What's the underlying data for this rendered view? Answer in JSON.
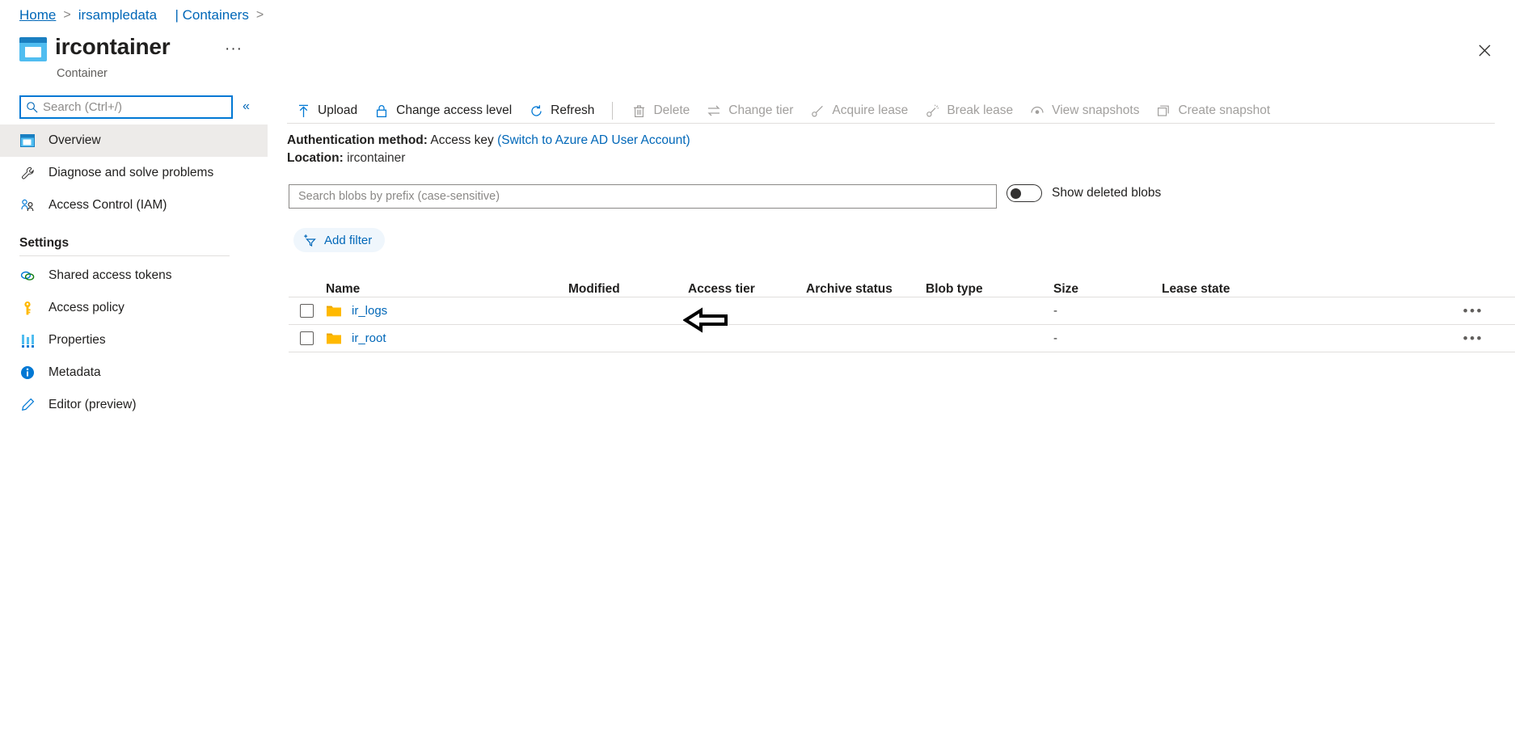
{
  "breadcrumb": {
    "items": [
      {
        "label": "Home",
        "underline": true
      },
      {
        "label": "irsampledata",
        "underline": false
      },
      {
        "label": "| Containers",
        "underline": false
      }
    ],
    "separator": ">"
  },
  "header": {
    "title": "ircontainer",
    "subtitle": "Container",
    "ellipsis": "···",
    "close_icon": "close-icon",
    "resource_icon": "container-icon"
  },
  "sidebar": {
    "search": {
      "placeholder": "Search (Ctrl+/)",
      "value": "",
      "icon": "search-icon"
    },
    "collapse": {
      "label": "«"
    },
    "items": [
      {
        "label": "Overview",
        "icon": "overview-icon",
        "selected": true
      },
      {
        "label": "Diagnose and solve problems",
        "icon": "wrench-icon",
        "selected": false
      },
      {
        "label": "Access Control (IAM)",
        "icon": "people-icon",
        "selected": false
      }
    ],
    "settings_group": {
      "title": "Settings",
      "items": [
        {
          "label": "Shared access tokens",
          "icon": "link-icon"
        },
        {
          "label": "Access policy",
          "icon": "key-icon"
        },
        {
          "label": "Properties",
          "icon": "bars-icon"
        },
        {
          "label": "Metadata",
          "icon": "info-icon"
        },
        {
          "label": "Editor (preview)",
          "icon": "pencil-icon"
        }
      ]
    }
  },
  "toolbar": {
    "buttons": [
      {
        "label": "Upload",
        "icon": "upload-icon",
        "disabled": false
      },
      {
        "label": "Change access level",
        "icon": "lock-icon",
        "disabled": false
      },
      {
        "label": "Refresh",
        "icon": "refresh-icon",
        "disabled": false
      },
      {
        "separator": true
      },
      {
        "label": "Delete",
        "icon": "trash-icon",
        "disabled": true
      },
      {
        "label": "Change tier",
        "icon": "swap-icon",
        "disabled": true
      },
      {
        "label": "Acquire lease",
        "icon": "lease-icon",
        "disabled": true
      },
      {
        "label": "Break lease",
        "icon": "break-lease-icon",
        "disabled": true
      },
      {
        "label": "View snapshots",
        "icon": "snapshot-icon",
        "disabled": true
      },
      {
        "label": "Create snapshot",
        "icon": "create-snapshot-icon",
        "disabled": true
      }
    ]
  },
  "info": {
    "auth_label": "Authentication method:",
    "auth_value": "Access key",
    "auth_switch_link": "(Switch to Azure AD User Account)",
    "location_label": "Location:",
    "location_value": "ircontainer"
  },
  "filters": {
    "blob_search_placeholder": "Search blobs by prefix (case-sensitive)",
    "blob_search_value": "",
    "show_deleted_label": "Show deleted blobs",
    "show_deleted_on": false,
    "add_filter_label": "Add filter",
    "add_filter_icon": "add-filter-icon"
  },
  "table": {
    "columns": [
      "Name",
      "Modified",
      "Access tier",
      "Archive status",
      "Blob type",
      "Size",
      "Lease state"
    ],
    "rows": [
      {
        "name": "ir_logs",
        "icon": "folder-icon",
        "modified": "",
        "access_tier": "",
        "archive_status": "",
        "blob_type": "",
        "size": "-",
        "lease_state": "",
        "menu": "•••",
        "checked": false,
        "annotated": true
      },
      {
        "name": "ir_root",
        "icon": "folder-icon",
        "modified": "",
        "access_tier": "",
        "archive_status": "",
        "blob_type": "",
        "size": "-",
        "lease_state": "",
        "menu": "•••",
        "checked": false,
        "annotated": false
      }
    ]
  },
  "annotation": {
    "type": "left-arrow",
    "target": "ir_logs",
    "color": "#000000"
  },
  "colors": {
    "accent": "#0067b8",
    "azure_blue": "#0078d4",
    "folder_yellow": "#ffb900",
    "selected_bg": "#edebe9",
    "border": "#e1dfdd",
    "disabled_text": "#a19f9d"
  }
}
